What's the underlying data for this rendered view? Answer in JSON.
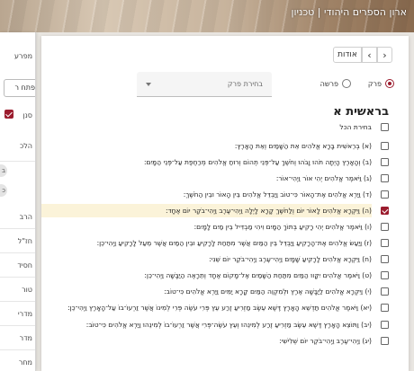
{
  "header": {
    "title": "ארון הספרים היהודי | טכניון"
  },
  "left_panel": {
    "items": [
      "מפרע",
      "פתח ר",
      "סנן",
      "הלכ",
      "ב",
      "כ",
      "הרב",
      "חז\"ל",
      "חסיד",
      "טור",
      "מדרי",
      "מדר",
      "מחר"
    ]
  },
  "nav": {
    "about_label": "אודות",
    "prev_icon": "chevron-left-icon",
    "next_icon": "chevron-right-icon"
  },
  "selector": {
    "chapter_radio": "פרק",
    "portion_radio": "פרשה",
    "selected": "פרק",
    "dropdown_placeholder": "בחירת פרק"
  },
  "chapter": {
    "title": "בראשית א"
  },
  "select_all_label": "בחירת הכל",
  "verses": [
    {
      "text": "(א) בְּרֵאשִׁית בָּרָא אֱלֹהִים אֵת הַשָּׁמַיִם וְאֵת הָאָרֶץ:",
      "checked": false
    },
    {
      "text": "(ב) וְהָאָרֶץ הָיְתָה תֹהוּ וָבֹהוּ וְחֹשֶׁךְ עַל־פְּנֵי תְהוֹם וְרוּחַ אֱלֹהִים מְרַחֶפֶת עַל־פְּנֵי הַמָּיִם:",
      "checked": false
    },
    {
      "text": "(ג) וַיֹּאמֶר אֱלֹהִים יְהִי אוֹר וַיְהִי־אוֹר:",
      "checked": false
    },
    {
      "text": "(ד) וַיַּרְא אֱלֹהִים אֶת־הָאוֹר כִּי־טוֹב וַיַּבְדֵּל אֱלֹהִים בֵּין הָאוֹר וּבֵין הַחֹשֶׁךְ:",
      "checked": false
    },
    {
      "text": "(ה) וַיִּקְרָא אֱלֹהִים לָאוֹר יוֹם וְלַחֹשֶׁךְ קָרָא לָיְלָה וַיְהִי־עֶרֶב וַיְהִי־בֹקֶר יוֹם אֶחָד:",
      "checked": true
    },
    {
      "text": "(ו) וַיֹּאמֶר אֱלֹהִים יְהִי רָקִיעַ בְּתוֹךְ הַמָּיִם וִיהִי מַבְדִּיל בֵּין מַיִם לָמָיִם:",
      "checked": false
    },
    {
      "text": "(ז) וַיַּעַשׂ אֱלֹהִים אֶת־הָרָקִיעַ וַיַּבְדֵּל בֵּין הַמַּיִם אֲשֶׁר מִתַּחַת לָרָקִיעַ וּבֵין הַמַּיִם אֲשֶׁר מֵעַל לָרָקִיעַ וַיְהִי־כֵן:",
      "checked": false
    },
    {
      "text": "(ח) וַיִּקְרָא אֱלֹהִים לָרָקִיעַ שָׁמָיִם וַיְהִי־עֶרֶב וַיְהִי־בֹקֶר יוֹם שֵׁנִי:",
      "checked": false
    },
    {
      "text": "(ט) וַיֹּאמֶר אֱלֹהִים יִקָּווּ הַמַּיִם מִתַּחַת הַשָּׁמַיִם אֶל־מָקוֹם אֶחָד וְתֵרָאֶה הַיַּבָּשָׁה וַיְהִי־כֵן:",
      "checked": false
    },
    {
      "text": "(י) וַיִּקְרָא אֱלֹהִים לַיַּבָּשָׁה אֶרֶץ וּלְמִקְוֵה הַמַּיִם קָרָא יַמִּים וַיַּרְא אֱלֹהִים כִּי־טוֹב:",
      "checked": false
    },
    {
      "text": "(יא) וַיֹּאמֶר אֱלֹהִים תַּדְשֵׁא הָאָרֶץ דֶּשֶׁא עֵשֶׂב מַזְרִיעַ זֶרַע עֵץ פְּרִי עֹשֶׂה פְּרִי לְמִינוֹ אֲשֶׁר זַרְעוֹ־בוֹ עַל־הָאָרֶץ וַיְהִי־כֵן:",
      "checked": false,
      "wrap": true
    },
    {
      "text": "(יב) וַתּוֹצֵא הָאָרֶץ דֶּשֶׁא עֵשֶׂב מַזְרִיעַ זֶרַע לְמִינֵהוּ וְעֵץ עֹשֶׂה־פְּרִי אֲשֶׁר זַרְעוֹ־בוֹ לְמִינֵהוּ וַיַּרְא אֱלֹהִים כִּי־טוֹב:",
      "checked": false
    },
    {
      "text": "(יג) וַיְהִי־עֶרֶב וַיְהִי־בֹקֶר יוֹם שְׁלִישִׁי:",
      "checked": false
    }
  ],
  "colors": {
    "accent": "#9b1c2e",
    "header": "#b9a690"
  }
}
